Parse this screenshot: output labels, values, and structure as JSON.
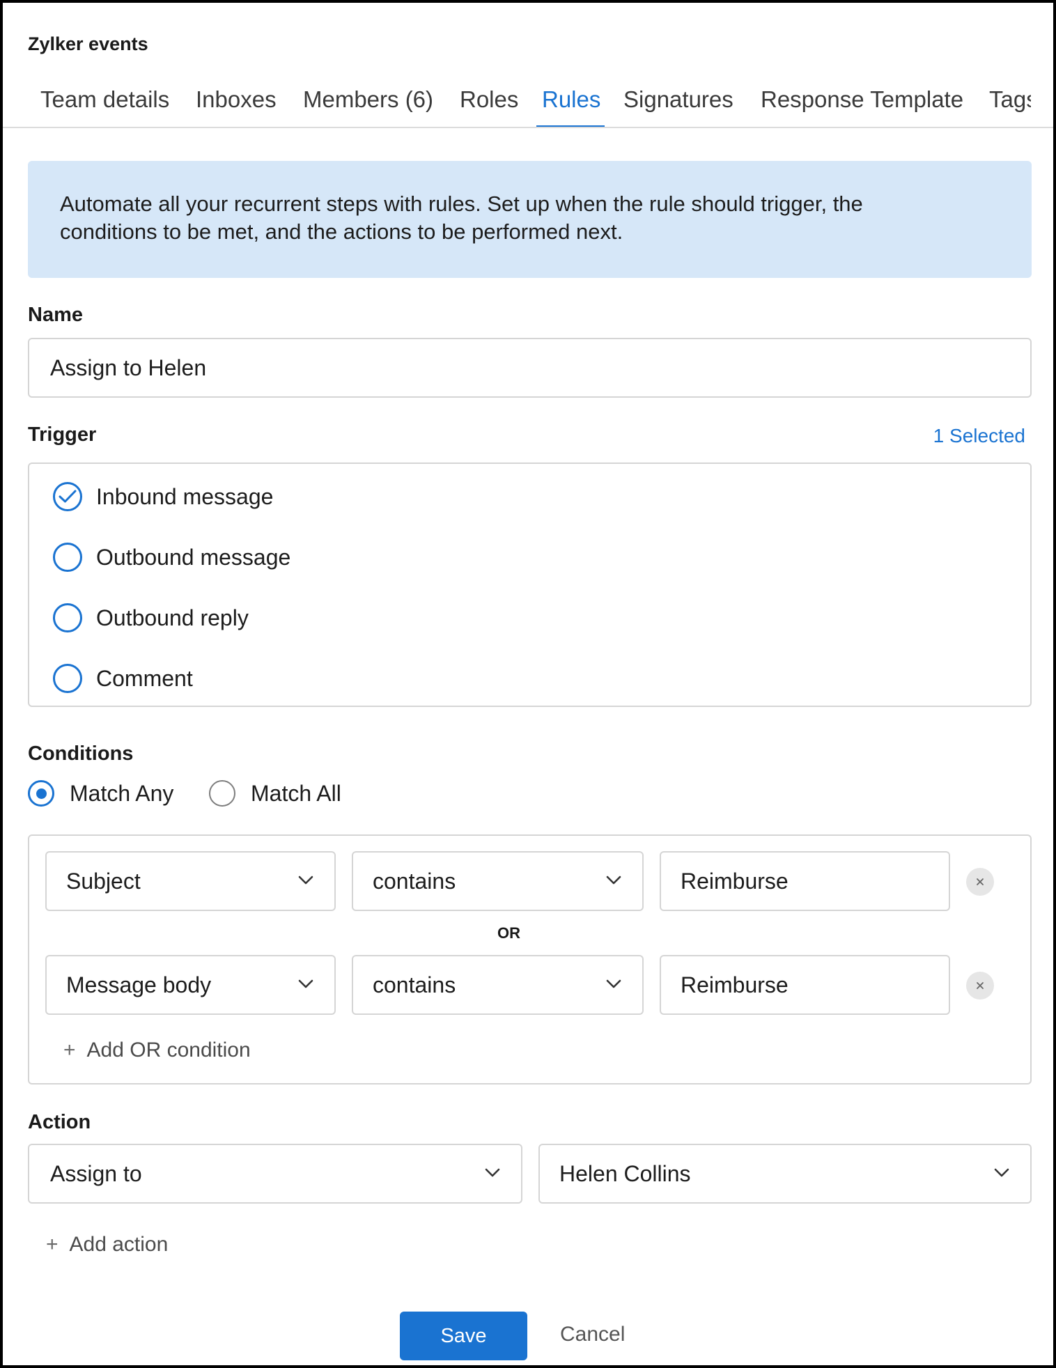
{
  "team": {
    "title": "Zylker events"
  },
  "tabs": [
    {
      "label": "Team details",
      "active": false
    },
    {
      "label": "Inboxes",
      "active": false
    },
    {
      "label": "Members (6)",
      "active": false
    },
    {
      "label": "Roles",
      "active": false
    },
    {
      "label": "Rules",
      "active": true
    },
    {
      "label": "Signatures",
      "active": false
    },
    {
      "label": "Response Template",
      "active": false
    },
    {
      "label": "Tags",
      "active": false
    }
  ],
  "banner": {
    "line1": "Automate all your recurrent steps with rules. Set up when the rule should trigger, the",
    "line2": "conditions to be met, and the actions to be performed next."
  },
  "name_section": {
    "label": "Name",
    "value": "Assign to Helen"
  },
  "trigger": {
    "label": "Trigger",
    "selected_count": "1 Selected",
    "options": [
      {
        "label": "Inbound message",
        "checked": true
      },
      {
        "label": "Outbound message",
        "checked": false
      },
      {
        "label": "Outbound reply",
        "checked": false
      },
      {
        "label": "Comment",
        "checked": false
      }
    ]
  },
  "conditions": {
    "label": "Conditions",
    "match_any": "Match Any",
    "match_all": "Match All",
    "selected_mode": "Match Any",
    "rows": [
      {
        "field": "Subject",
        "operator": "contains",
        "value": "Reimburse"
      },
      {
        "field": "Message body",
        "operator": "contains",
        "value": "Reimburse"
      }
    ],
    "joiner": "OR",
    "add_label": "Add OR condition"
  },
  "action": {
    "label": "Action",
    "type": "Assign to",
    "target": "Helen Collins",
    "add_label": "Add action"
  },
  "footer": {
    "save_label": "Save",
    "cancel_label": "Cancel"
  },
  "colors": {
    "accent": "#1a73d1",
    "banner_bg": "#d6e7f8",
    "border": "#d5d5d5"
  },
  "icons": {
    "check": "check-circle-icon",
    "chevron": "chevron-down-icon",
    "remove": "close-icon",
    "plus": "plus-icon"
  }
}
